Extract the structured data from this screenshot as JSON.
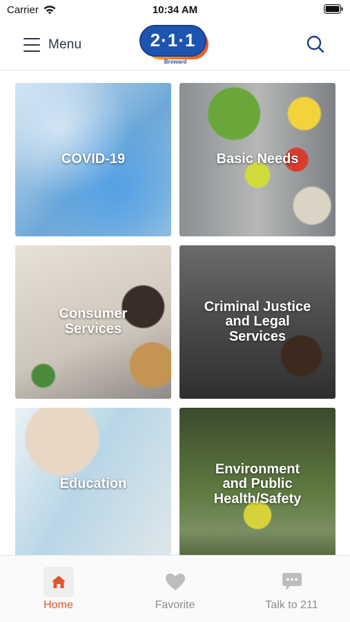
{
  "status_bar": {
    "carrier": "Carrier",
    "time": "10:34 AM"
  },
  "header": {
    "menu_label": "Menu",
    "logo_text": "2·1·1",
    "logo_subtext": "Broward"
  },
  "categories": [
    {
      "title": "COVID-19"
    },
    {
      "title": "Basic Needs"
    },
    {
      "title": "Consumer\nServices"
    },
    {
      "title": "Criminal Justice\nand Legal\nServices"
    },
    {
      "title": "Education"
    },
    {
      "title": "Environment\nand Public\nHealth/Safety"
    }
  ],
  "tabbar": {
    "active": "Home",
    "tabs": [
      {
        "label": "Home",
        "icon": "home-icon"
      },
      {
        "label": "Favorite",
        "icon": "heart-icon"
      },
      {
        "label": "Talk to 211",
        "icon": "chat-bubble-icon"
      }
    ]
  },
  "colors": {
    "accent": "#e0532f",
    "brand_blue": "#1d54b0",
    "brand_orange": "#f5a623",
    "text_dark": "#2d3547",
    "tab_inactive": "#8c8c8c"
  }
}
